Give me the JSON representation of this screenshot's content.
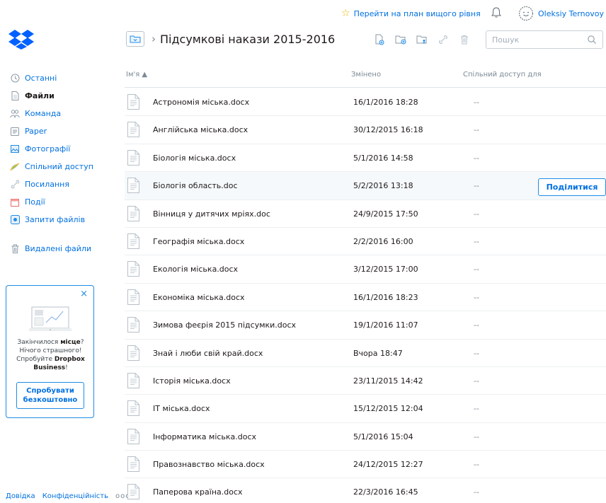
{
  "topbar": {
    "upgrade_label": "Перейти на план вищого рівня",
    "user_name": "Oleksiy Ternovoy"
  },
  "header": {
    "title": "Підсумкові накази 2015-2016",
    "separator": "›"
  },
  "search": {
    "placeholder": "Пошук"
  },
  "sidebar": {
    "items": [
      {
        "label": "Останні",
        "icon": "clock-icon"
      },
      {
        "label": "Файли",
        "icon": "file-icon",
        "active": true
      },
      {
        "label": "Команда",
        "icon": "team-icon"
      },
      {
        "label": "Paper",
        "icon": "paper-icon"
      },
      {
        "label": "Фотографії",
        "icon": "photo-icon"
      },
      {
        "label": "Спільний доступ",
        "icon": "shared-icon"
      },
      {
        "label": "Посилання",
        "icon": "link-icon"
      },
      {
        "label": "Події",
        "icon": "calendar-icon"
      },
      {
        "label": "Запити файлів",
        "icon": "file-request-icon"
      }
    ],
    "deleted": {
      "label": "Видалені файли",
      "icon": "trash-icon"
    }
  },
  "promo": {
    "close": "×",
    "line1_pre": "Закінчилося ",
    "line1_bold": "місце",
    "line1_post": "?",
    "line2": "Нічого страшного!",
    "line3_pre": "Спробуйте ",
    "line3_bold": "Dropbox Business",
    "line3_post": "!",
    "button": "Спробувати безкоштовно"
  },
  "footer": {
    "help": "Довідка",
    "privacy": "Конфіденційність",
    "more": "ооо"
  },
  "table": {
    "columns": {
      "name": "Ім'я ▲",
      "modified": "Змінено",
      "shared": "Спільний доступ для"
    },
    "share_button": "Поділитися",
    "rows": [
      {
        "name": "Астрономія міська.docx",
        "modified": "16/1/2016 18:28",
        "shared": "--"
      },
      {
        "name": "Англійська міська.docx",
        "modified": "30/12/2015 16:18",
        "shared": "--"
      },
      {
        "name": "Біологія міська.docx",
        "modified": "5/1/2016 14:58",
        "shared": "--"
      },
      {
        "name": "Біологія область.doc",
        "modified": "5/2/2016 13:18",
        "shared": "--",
        "hover": true
      },
      {
        "name": "Вінниця у дитячих мріях.doc",
        "modified": "24/9/2015 17:50",
        "shared": "--"
      },
      {
        "name": "Географія міська.docx",
        "modified": "2/2/2016 16:00",
        "shared": "--"
      },
      {
        "name": "Екологія міська.docx",
        "modified": "3/12/2015 17:00",
        "shared": "--"
      },
      {
        "name": "Економіка міська.docx",
        "modified": "16/1/2016 18:23",
        "shared": "--"
      },
      {
        "name": "Зимова феєрія 2015 підсумки.docx",
        "modified": "19/1/2016 11:07",
        "shared": "--"
      },
      {
        "name": "Знай і люби свій край.docx",
        "modified": "Вчора 18:47",
        "shared": "--"
      },
      {
        "name": "Історія міська.docx",
        "modified": "23/11/2015 14:42",
        "shared": "--"
      },
      {
        "name": "ІТ міська.docx",
        "modified": "15/12/2015 12:04",
        "shared": "--"
      },
      {
        "name": "Інформатика міська.docx",
        "modified": "5/1/2016 15:04",
        "shared": "--"
      },
      {
        "name": "Правознавство міська.docx",
        "modified": "24/12/2015 12:27",
        "shared": "--"
      },
      {
        "name": "Паперова країна.docx",
        "modified": "22/3/2016 16:45",
        "shared": "--"
      }
    ]
  },
  "colors": {
    "accent": "#0070e0",
    "border_accent": "#1f8ce6",
    "star": "#f0b400"
  }
}
